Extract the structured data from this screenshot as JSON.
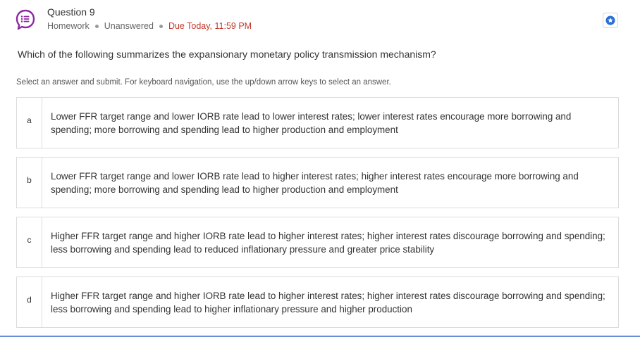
{
  "header": {
    "title": "Question 9",
    "type": "Homework",
    "status": "Unanswered",
    "due": "Due Today, 11:59 PM",
    "icon": "question-chat-icon",
    "accent_color": "#8e2aa0",
    "due_color": "#c0392b"
  },
  "question": {
    "text": "Which of the following summarizes the expansionary monetary policy transmission mechanism?",
    "instructions": "Select an answer and submit. For keyboard navigation, use the up/down arrow keys to select an answer."
  },
  "choices": [
    {
      "letter": "a",
      "text": "Lower FFR target range and lower IORB rate lead to lower interest rates; lower interest rates encourage more borrowing and spending; more borrowing and spending lead to higher production and employment"
    },
    {
      "letter": "b",
      "text": "Lower FFR target range and lower IORB rate lead to higher interest rates; higher interest rates encourage more borrowing and spending; more borrowing and spending lead to higher production and employment"
    },
    {
      "letter": "c",
      "text": "Higher FFR target range and higher IORB rate lead to higher interest rates; higher interest rates discourage borrowing and spending; less borrowing and spending lead to reduced inflationary pressure and greater price stability"
    },
    {
      "letter": "d",
      "text": "Higher FFR target range and higher IORB rate lead to higher interest rates; higher interest rates discourage borrowing and spending; less borrowing and spending lead to higher inflationary pressure and higher production"
    }
  ],
  "toolbar": {
    "star_icon": "star-badge-icon",
    "star_color": "#2a6fd6"
  }
}
